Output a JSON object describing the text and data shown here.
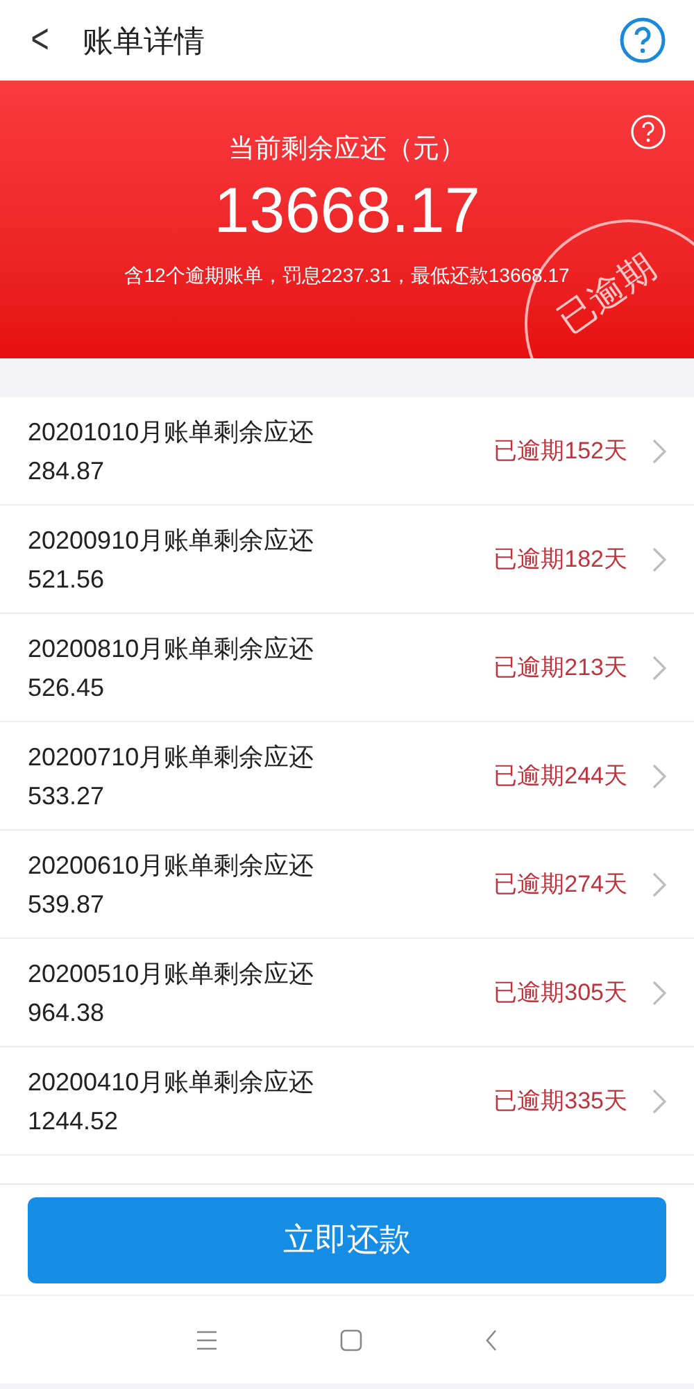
{
  "header": {
    "back": "<",
    "title": "账单详情"
  },
  "summary": {
    "label": "当前剩余应还（元）",
    "amount": "13668.17",
    "detail": "含12个逾期账单，罚息2237.31，最低还款13668.17",
    "stamp": "已逾期"
  },
  "bills": [
    {
      "title": "20201010月账单剩余应还",
      "amount": "284.87",
      "status": "已逾期152天"
    },
    {
      "title": "20200910月账单剩余应还",
      "amount": "521.56",
      "status": "已逾期182天"
    },
    {
      "title": "20200810月账单剩余应还",
      "amount": "526.45",
      "status": "已逾期213天"
    },
    {
      "title": "20200710月账单剩余应还",
      "amount": "533.27",
      "status": "已逾期244天"
    },
    {
      "title": "20200610月账单剩余应还",
      "amount": "539.87",
      "status": "已逾期274天"
    },
    {
      "title": "20200510月账单剩余应还",
      "amount": "964.38",
      "status": "已逾期305天"
    },
    {
      "title": "20200410月账单剩余应还",
      "amount": "1244.52",
      "status": "已逾期335天"
    }
  ],
  "pay_button": "立即还款"
}
